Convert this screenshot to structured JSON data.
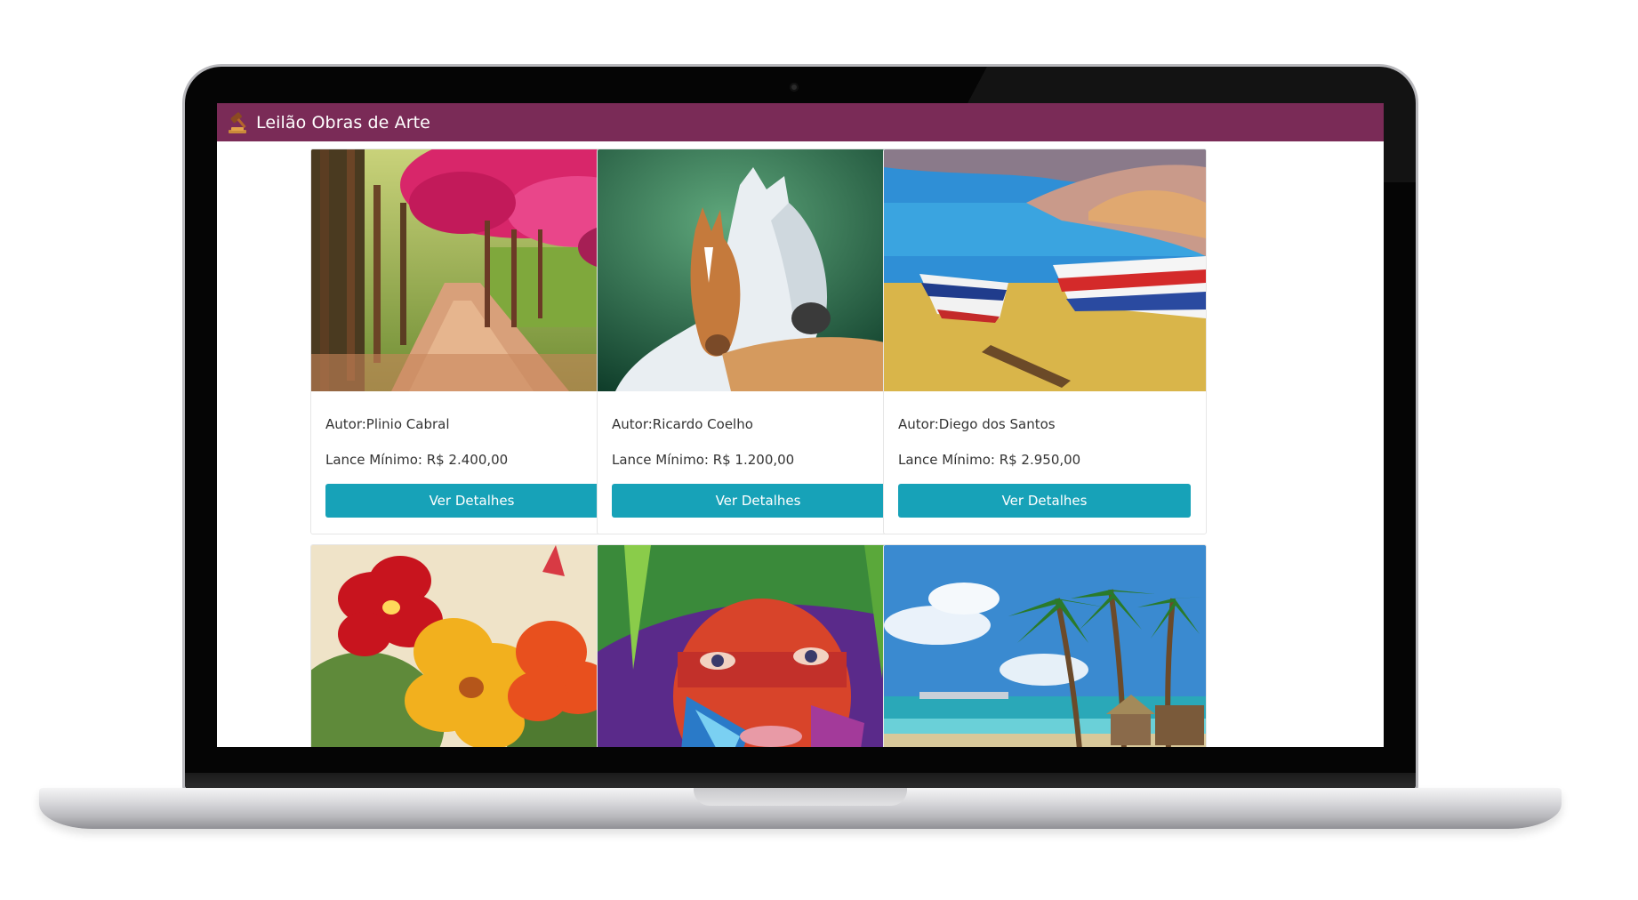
{
  "app": {
    "title": "Leilão Obras de Arte",
    "brand_color": "#7a2b57",
    "icon": "auction-gavel-icon"
  },
  "button_color": "#17a2b8",
  "cards": [
    {
      "author": "Autor:Plinio Cabral",
      "price": "Lance Mínimo: R$ 2.400,00",
      "button": "Ver Detalhes",
      "image": "pink-tree-path-painting"
    },
    {
      "author": "Autor:Ricardo Coelho",
      "price": "Lance Mínimo: R$ 1.200,00",
      "button": "Ver Detalhes",
      "image": "horses-painting"
    },
    {
      "author": "Autor:Diego dos Santos",
      "price": "Lance Mínimo: R$ 2.950,00",
      "button": "Ver Detalhes",
      "image": "boats-on-beach-painting"
    },
    {
      "image": "hibiscus-flowers-painting"
    },
    {
      "image": "indigenous-face-painting"
    },
    {
      "image": "palm-beach-painting"
    }
  ]
}
